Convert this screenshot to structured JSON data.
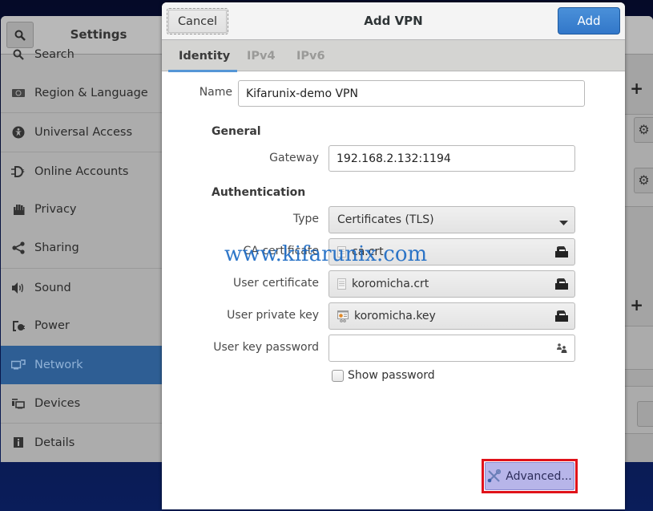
{
  "settings": {
    "title": "Settings",
    "sidebar": [
      {
        "label": "Search",
        "icon": "search-icon"
      },
      {
        "label": "Region & Language",
        "icon": "region-icon"
      },
      {
        "label": "Universal Access",
        "icon": "universal-access-icon"
      },
      {
        "label": "Online Accounts",
        "icon": "online-accounts-icon"
      },
      {
        "label": "Privacy",
        "icon": "privacy-hand-icon"
      },
      {
        "label": "Sharing",
        "icon": "share-icon"
      },
      {
        "label": "Sound",
        "icon": "speaker-icon"
      },
      {
        "label": "Power",
        "icon": "power-icon"
      },
      {
        "label": "Network",
        "icon": "network-icon",
        "active": true
      },
      {
        "label": "Devices",
        "icon": "devices-icon"
      },
      {
        "label": "Details",
        "icon": "info-icon"
      }
    ],
    "right_panel": {
      "plus_label": "+",
      "gear_label": "⚙"
    }
  },
  "dialog": {
    "title": "Add VPN",
    "cancel_label": "Cancel",
    "add_label": "Add",
    "tabs": [
      {
        "label": "Identity",
        "active": true
      },
      {
        "label": "IPv4"
      },
      {
        "label": "IPv6"
      }
    ],
    "name": {
      "label": "Name",
      "value": "Kifarunix-demo VPN"
    },
    "general": {
      "heading": "General",
      "gateway": {
        "label": "Gateway",
        "value": "192.168.2.132:1194"
      }
    },
    "authentication": {
      "heading": "Authentication",
      "type": {
        "label": "Type",
        "value": "Certificates (TLS)"
      },
      "ca_certificate": {
        "label": "CA certificate",
        "value": "ca.crt"
      },
      "user_certificate": {
        "label": "User certificate",
        "value": "koromicha.crt"
      },
      "user_private_key": {
        "label": "User private key",
        "value": "koromicha.key"
      },
      "user_key_password": {
        "label": "User key password",
        "value": ""
      },
      "show_password": {
        "label": "Show password",
        "checked": false
      }
    },
    "advanced_label": "Advanced..."
  },
  "watermark": "www.kifarunix.com",
  "colors": {
    "accent": "#3277c9",
    "sidebar_active": "#2e5e94",
    "highlight_box": "#e0121a",
    "advanced_button": "#b7b5e9",
    "watermark": "#1d6bc4"
  }
}
